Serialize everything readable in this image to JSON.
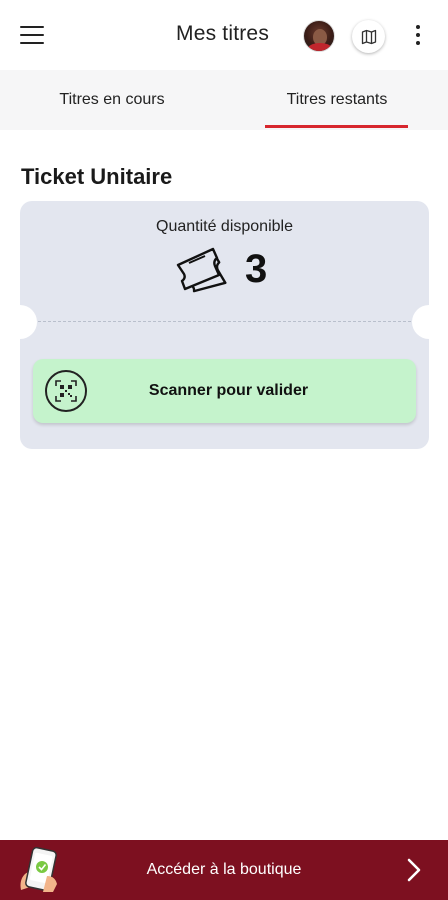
{
  "header": {
    "title": "Mes titres",
    "menu_icon": "hamburger-menu-icon",
    "avatar_icon": "user-avatar",
    "map_icon": "map-icon",
    "more_icon": "more-vertical-icon"
  },
  "tabs": [
    {
      "label": "Titres en cours",
      "active": false
    },
    {
      "label": "Titres restants",
      "active": true
    }
  ],
  "section": {
    "title": "Ticket Unitaire"
  },
  "ticket": {
    "quantity_label": "Quantité disponible",
    "quantity_value": "3",
    "ticket_icon": "tickets-icon",
    "scan_button": {
      "label": "Scanner pour valider",
      "icon": "qr-code-icon"
    }
  },
  "footer": {
    "label": "Accéder à la boutique",
    "illustration": "phone-shop-icon",
    "chevron_icon": "chevron-right-icon"
  },
  "colors": {
    "accent_red": "#d7262e",
    "footer_bg": "#7d1020",
    "ticket_bg": "#e3e6ef",
    "scan_bg": "#c5f3cc",
    "tabs_bg": "#f6f6f7"
  }
}
